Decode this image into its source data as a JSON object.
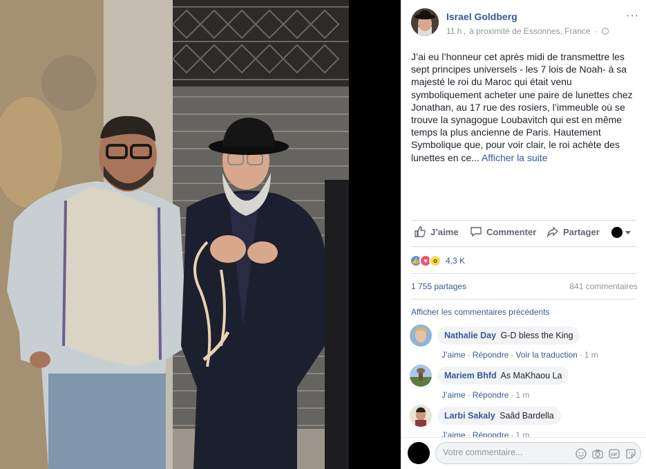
{
  "post": {
    "author": "Israel Goldberg",
    "time": "11 h",
    "location": "à proximité de Essonnes, France",
    "text": "J’ai eu l’honneur cet après midi de transmettre les sept principes universels - les 7 lois de Noah- à sa majesté le roi du Maroc qui était venu symboliquement acheter une paire de lunettes chez Jonathan, au 17 rue des rosiers, l’immeuble où se trouve la synagogue Loubavitch qui est en même temps la plus ancienne de Paris. Hautement Symbolique que, pour voir clair, le roi achète des lunettes en ce...",
    "see_more": "Afficher la suite"
  },
  "actions": {
    "like": "J’aime",
    "comment": "Commenter",
    "share": "Partager"
  },
  "reactions": {
    "types": [
      "like",
      "love",
      "wow"
    ],
    "count": "4,3 K"
  },
  "stats": {
    "shares": "1 755 partages",
    "comments": "841 commentaires"
  },
  "prev_comments": "Afficher les commentaires précédents",
  "comments": [
    {
      "name": "Nathalie Day",
      "text": "G-D bless the King",
      "like": "J’aime",
      "reply": "Répondre",
      "translate": "Voir la traduction",
      "time": "1 m"
    },
    {
      "name": "Mariem Bhfd",
      "text": "As MaKhaou La",
      "like": "J’aime",
      "reply": "Répondre",
      "time": "1 m"
    },
    {
      "name": "Larbi Sakaly",
      "text": "Saâd Bardella",
      "like": "J’aime",
      "reply": "Répondre",
      "time": "1 m"
    }
  ],
  "composer": {
    "placeholder": "Votre commentaire..."
  },
  "colors": {
    "link": "#385898",
    "meta": "#90949c",
    "bubble": "#f2f3f5"
  }
}
